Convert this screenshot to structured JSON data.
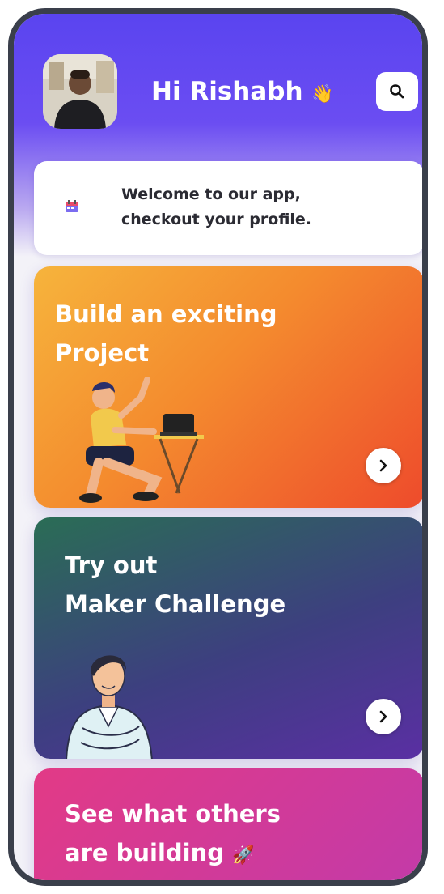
{
  "header": {
    "greeting": "Hi Rishabh",
    "wave_emoji": "👋",
    "avatar_alt": "profile-photo",
    "search_icon": "search-icon"
  },
  "welcome": {
    "text": "Welcome to our app,\ncheckout your profile.",
    "icon": "calendar-icon"
  },
  "cards": [
    {
      "title": "Build an exciting\nProject",
      "button_icon": "chevron-right-icon"
    },
    {
      "title": "Try out\nMaker Challenge",
      "button_icon": "chevron-right-icon"
    },
    {
      "title": "See what others\nare building",
      "trailing_emoji": "🚀"
    }
  ],
  "colors": {
    "brand": "#5a44f0",
    "card_orange": "#f48b2e",
    "card_purple": "#4a3a90",
    "card_pink": "#d93a96"
  }
}
